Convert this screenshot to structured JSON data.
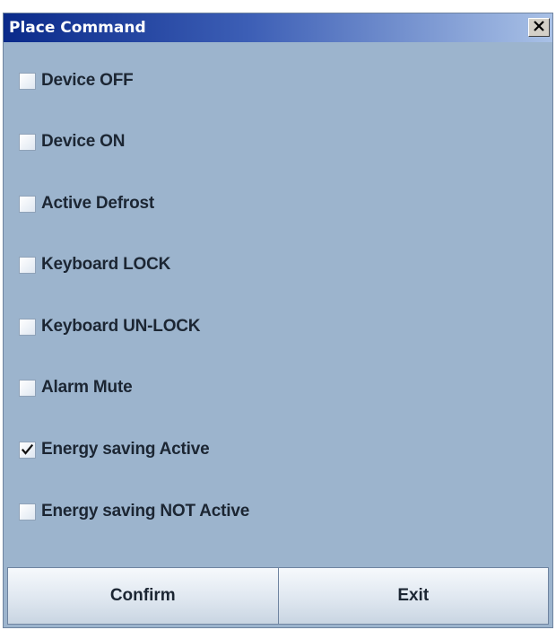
{
  "window": {
    "title": "Place Command",
    "close_icon": "close-icon"
  },
  "options": [
    {
      "label": "Device OFF",
      "checked": false
    },
    {
      "label": "Device ON",
      "checked": false
    },
    {
      "label": "Active Defrost",
      "checked": false
    },
    {
      "label": "Keyboard LOCK",
      "checked": false
    },
    {
      "label": "Keyboard UN-LOCK",
      "checked": false
    },
    {
      "label": "Alarm Mute",
      "checked": false
    },
    {
      "label": "Energy saving Active",
      "checked": true
    },
    {
      "label": "Energy saving NOT Active",
      "checked": false
    }
  ],
  "buttons": {
    "confirm_label": "Confirm",
    "exit_label": "Exit"
  },
  "colors": {
    "window_background": "#9cb4cd",
    "titlebar_start": "#0a2a8a",
    "titlebar_end": "#a9c1e6"
  }
}
